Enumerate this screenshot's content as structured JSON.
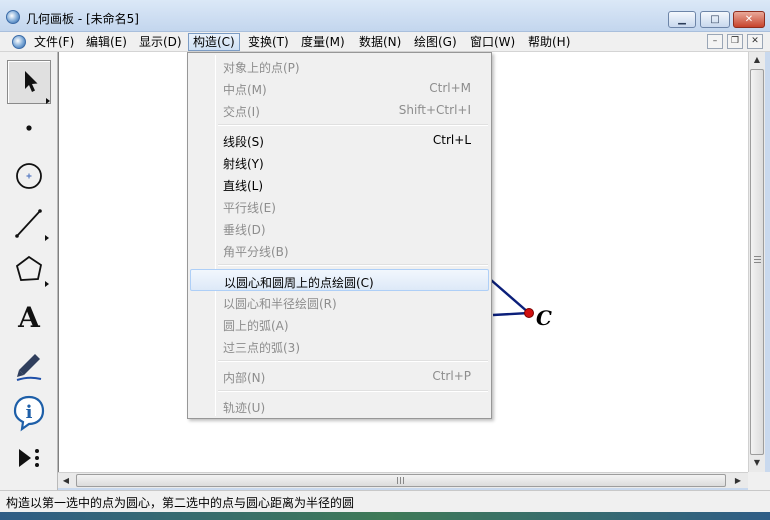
{
  "window": {
    "title": "几何画板 - [未命名5]",
    "controls": {
      "minimize": "▁",
      "maximize": "□",
      "close": "✕"
    }
  },
  "menubar": {
    "items": [
      {
        "label": "文件(F)"
      },
      {
        "label": "编辑(E)"
      },
      {
        "label": "显示(D)"
      },
      {
        "label": "构造(C)"
      },
      {
        "label": "变换(T)"
      },
      {
        "label": "度量(M)"
      },
      {
        "label": "数据(N)"
      },
      {
        "label": "绘图(G)"
      },
      {
        "label": "窗口(W)"
      },
      {
        "label": "帮助(H)"
      }
    ],
    "active_index": 3,
    "mdi_controls": {
      "minimize": "–",
      "restore": "❐",
      "close": "✕"
    }
  },
  "construct_menu": {
    "items": [
      {
        "label": "对象上的点(P)",
        "shortcut": "",
        "enabled": false
      },
      {
        "label": "中点(M)",
        "shortcut": "Ctrl+M",
        "enabled": false
      },
      {
        "label": "交点(I)",
        "shortcut": "Shift+Ctrl+I",
        "enabled": false
      },
      {
        "label": "线段(S)",
        "shortcut": "Ctrl+L",
        "enabled": true
      },
      {
        "label": "射线(Y)",
        "shortcut": "",
        "enabled": true
      },
      {
        "label": "直线(L)",
        "shortcut": "",
        "enabled": true
      },
      {
        "label": "平行线(E)",
        "shortcut": "",
        "enabled": false
      },
      {
        "label": "垂线(D)",
        "shortcut": "",
        "enabled": false
      },
      {
        "label": "角平分线(B)",
        "shortcut": "",
        "enabled": false
      },
      {
        "label": "以圆心和圆周上的点绘圆(C)",
        "shortcut": "",
        "enabled": true,
        "highlighted": true
      },
      {
        "label": "以圆心和半径绘圆(R)",
        "shortcut": "",
        "enabled": false
      },
      {
        "label": "圆上的弧(A)",
        "shortcut": "",
        "enabled": false
      },
      {
        "label": "过三点的弧(3)",
        "shortcut": "",
        "enabled": false
      },
      {
        "label": "内部(N)",
        "shortcut": "Ctrl+P",
        "enabled": false
      },
      {
        "label": "轨迹(U)",
        "shortcut": "",
        "enabled": false
      }
    ]
  },
  "toolbox": {
    "tools": [
      {
        "icon": "arrow-select-tool-icon",
        "active": true
      },
      {
        "icon": "point-tool-icon"
      },
      {
        "icon": "compass-tool-icon"
      },
      {
        "icon": "straightedge-tool-icon"
      },
      {
        "icon": "polygon-tool-icon"
      },
      {
        "icon": "text-tool-icon",
        "glyph": "A"
      },
      {
        "icon": "marker-tool-icon"
      },
      {
        "icon": "information-tool-icon",
        "glyph": "i"
      },
      {
        "icon": "custom-tools-icon"
      }
    ]
  },
  "canvas": {
    "point_label": "C",
    "colors": {
      "segment": "#0b1f7a",
      "point": "#d01010"
    }
  },
  "statusbar": {
    "text": "构造以第一选中的点为圆心，第二选中的点与圆心距离为半径的圆"
  }
}
